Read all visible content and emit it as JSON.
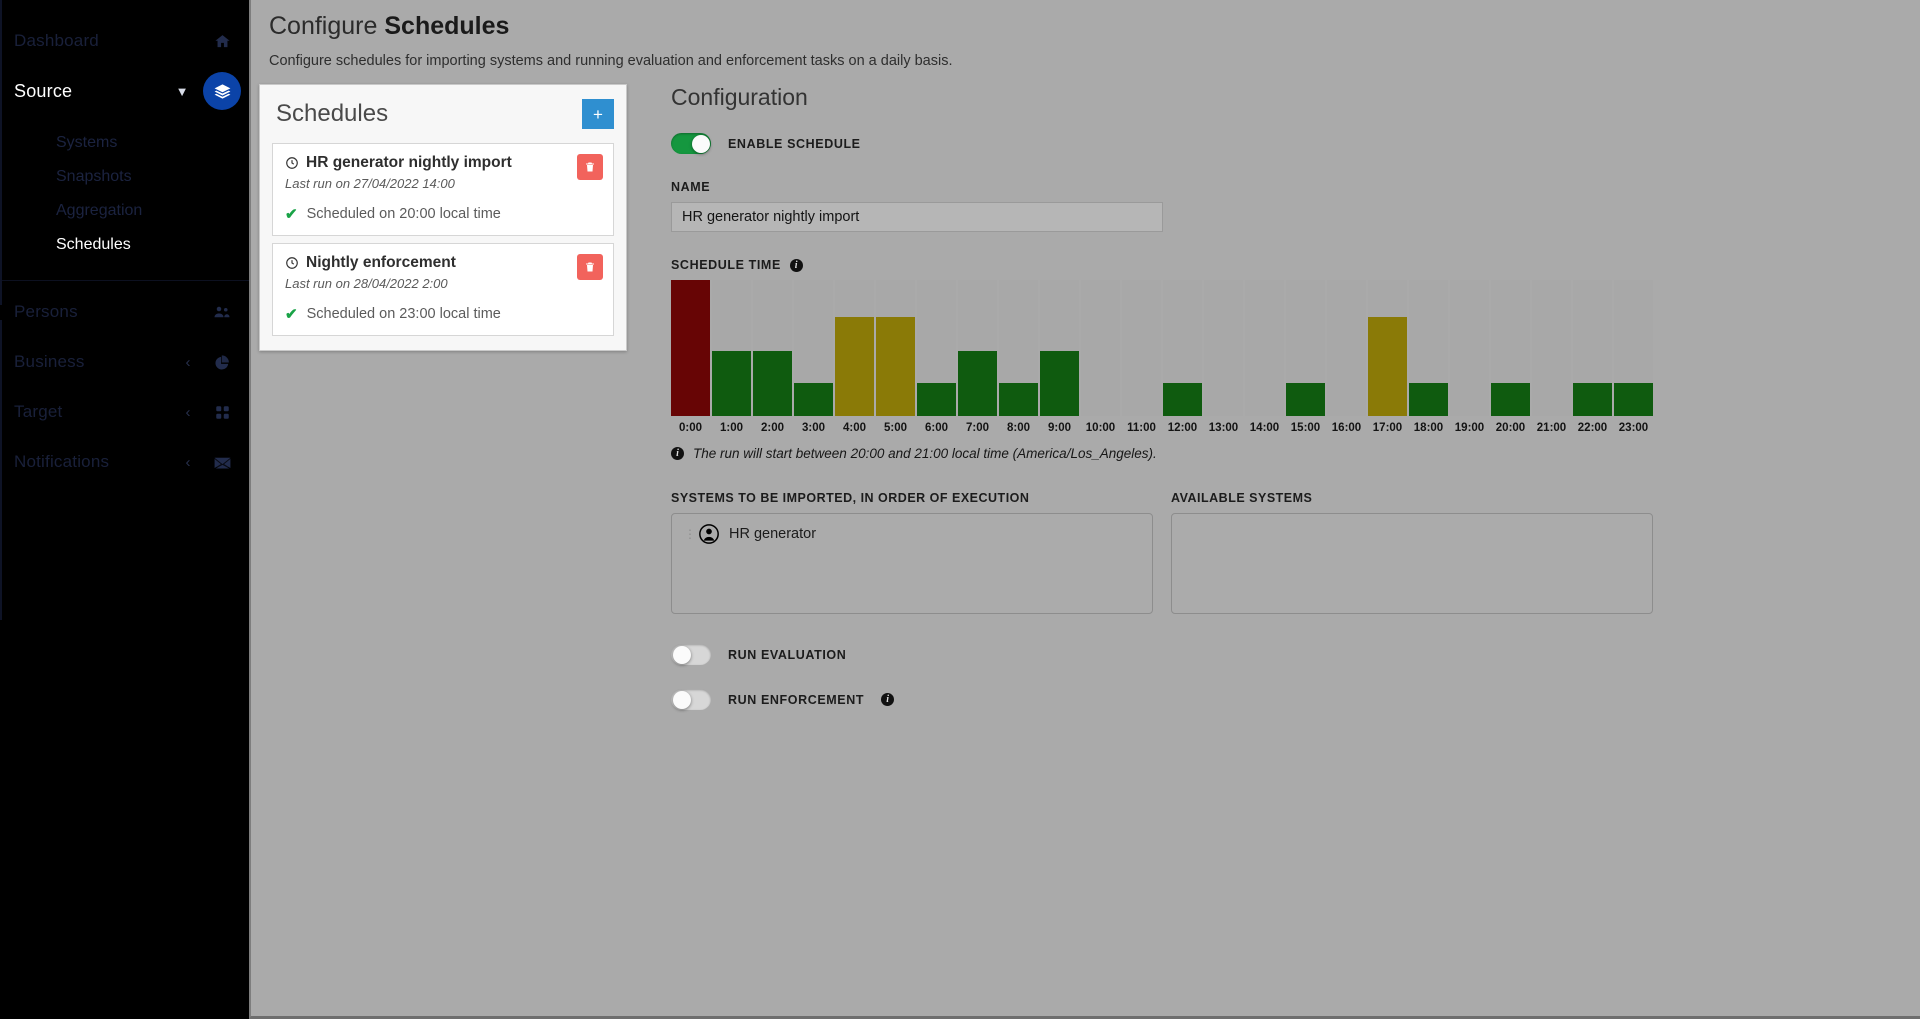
{
  "sidebar": {
    "items": [
      {
        "label": "Dashboard",
        "icon": "home-icon",
        "state": "dim"
      },
      {
        "label": "Source",
        "icon": "layers-icon",
        "state": "active-parent"
      }
    ],
    "sub_items": [
      {
        "label": "Systems",
        "active": false
      },
      {
        "label": "Snapshots",
        "active": false
      },
      {
        "label": "Aggregation",
        "active": false
      },
      {
        "label": "Schedules",
        "active": true
      }
    ],
    "lower_items": [
      {
        "label": "Persons",
        "icon": "people-icon",
        "chevron": ""
      },
      {
        "label": "Business",
        "icon": "pie-icon",
        "chevron": "‹"
      },
      {
        "label": "Target",
        "icon": "grid-icon",
        "chevron": "‹"
      },
      {
        "label": "Notifications",
        "icon": "mail-icon",
        "chevron": "‹"
      }
    ]
  },
  "header": {
    "title_prefix": "Configure ",
    "title_strong": "Schedules",
    "subtitle": "Configure schedules for importing systems and running evaluation and enforcement tasks on a daily basis."
  },
  "schedules_panel": {
    "title": "Schedules",
    "add_label": "+",
    "delete_icon": "trash-icon",
    "cards": [
      {
        "name": "HR generator nightly import",
        "last_run": "Last run on 27/04/2022 14:00",
        "status": "Scheduled on 20:00 local time",
        "selected": true
      },
      {
        "name": "Nightly enforcement",
        "last_run": "Last run on 28/04/2022 2:00",
        "status": "Scheduled on 23:00 local time",
        "selected": false
      }
    ]
  },
  "configuration": {
    "title": "Configuration",
    "enable_schedule": {
      "label": "ENABLE SCHEDULE",
      "on": true
    },
    "name": {
      "label": "NAME",
      "value": "HR generator nightly import"
    },
    "schedule_time_label": "SCHEDULE TIME",
    "chart_note": "The run will start between 20:00 and 21:00 local time (America/Los_Angeles).",
    "systems_imported": {
      "label": "SYSTEMS TO BE IMPORTED, IN ORDER OF EXECUTION",
      "items": [
        {
          "name": "HR generator",
          "icon": "avatar-icon"
        }
      ]
    },
    "available_systems": {
      "label": "AVAILABLE SYSTEMS",
      "items": []
    },
    "run_evaluation": {
      "label": "RUN EVALUATION",
      "on": false
    },
    "run_enforcement": {
      "label": "RUN ENFORCEMENT",
      "on": false
    }
  },
  "colors": {
    "accent_blue": "#0b43a8",
    "add_button": "#2f8fd0",
    "delete_button": "#f2635c",
    "toggle_on": "#15973f",
    "bar_green": "#0f5b0f",
    "bar_olive": "#8a7a07",
    "bar_red": "#670505",
    "bar_track": "#a8a8a8",
    "check_green": "#19a347"
  },
  "chart_data": {
    "type": "bar",
    "title": "SCHEDULE TIME",
    "xlabel": "",
    "ylabel": "",
    "ylim": [
      0,
      100
    ],
    "grid": false,
    "legend": "none",
    "categories": [
      "0:00",
      "1:00",
      "2:00",
      "3:00",
      "4:00",
      "5:00",
      "6:00",
      "7:00",
      "8:00",
      "9:00",
      "10:00",
      "11:00",
      "12:00",
      "13:00",
      "14:00",
      "15:00",
      "16:00",
      "17:00",
      "18:00",
      "19:00",
      "20:00",
      "21:00",
      "22:00",
      "23:00"
    ],
    "values": [
      100,
      48,
      48,
      24,
      73,
      73,
      24,
      48,
      24,
      48,
      0,
      0,
      24,
      0,
      0,
      24,
      0,
      73,
      24,
      0,
      24,
      0,
      24,
      24
    ],
    "bar_colors": [
      "red",
      "green",
      "green",
      "green",
      "olive",
      "olive",
      "green",
      "green",
      "green",
      "green",
      "none",
      "none",
      "green",
      "none",
      "none",
      "green",
      "none",
      "olive",
      "green",
      "none",
      "green",
      "none",
      "green",
      "green"
    ]
  }
}
